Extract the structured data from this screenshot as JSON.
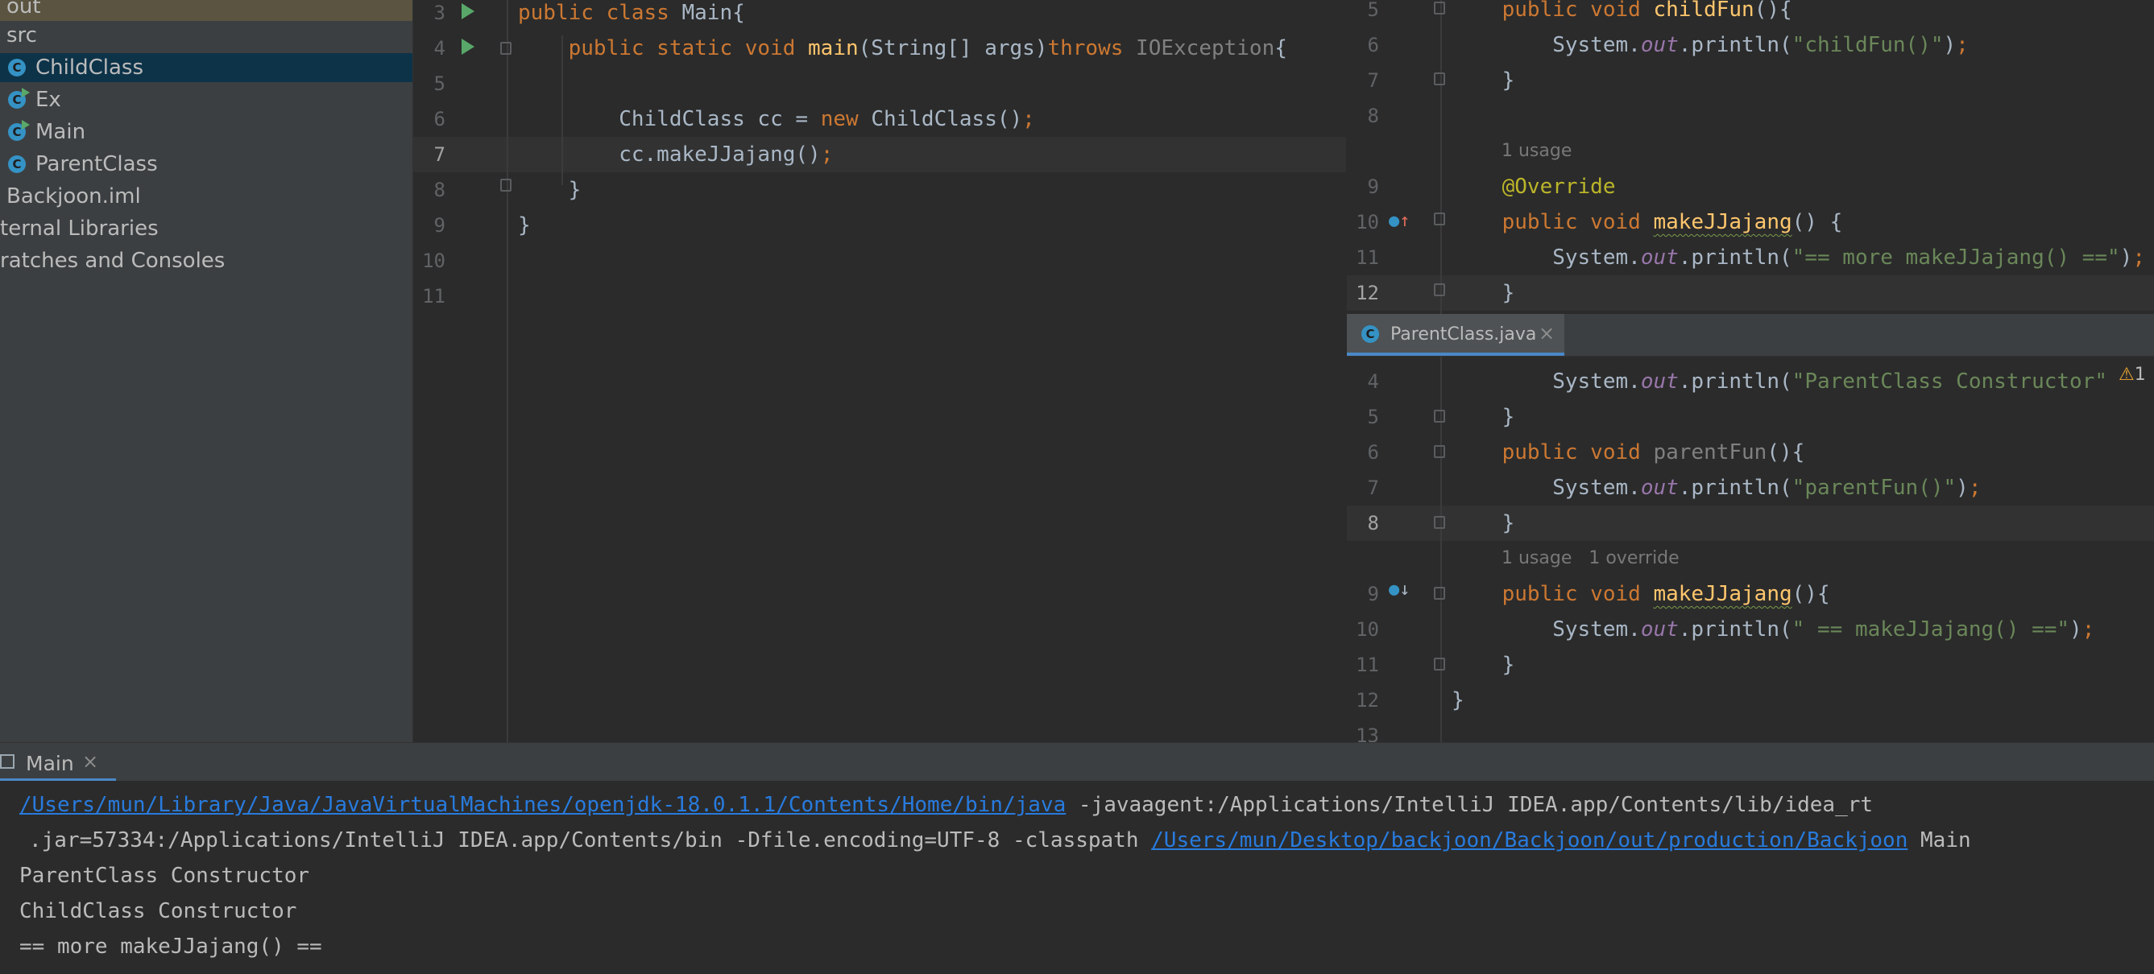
{
  "tree": {
    "items": [
      {
        "label": "out",
        "icon": "",
        "indent": 0,
        "state": "top"
      },
      {
        "label": "src",
        "icon": "",
        "indent": 0,
        "state": ""
      },
      {
        "label": "ChildClass",
        "icon": "class-icon",
        "indent": 1,
        "state": "selected"
      },
      {
        "label": "Ex",
        "icon": "runnable-class-icon",
        "indent": 1,
        "state": ""
      },
      {
        "label": "Main",
        "icon": "runnable-class-icon",
        "indent": 1,
        "state": ""
      },
      {
        "label": "ParentClass",
        "icon": "class-icon",
        "indent": 1,
        "state": ""
      },
      {
        "label": "Backjoon.iml",
        "icon": "",
        "indent": 0,
        "state": ""
      },
      {
        "label": "ternal Libraries",
        "icon": "",
        "indent": 0,
        "state": ""
      },
      {
        "label": "ratches and Consoles",
        "icon": "",
        "indent": 0,
        "state": ""
      }
    ]
  },
  "main_editor": {
    "lines": [
      {
        "n": "3",
        "tokens": [
          {
            "t": "public class ",
            "c": "kw"
          },
          {
            "t": "Main{",
            "c": ""
          }
        ]
      },
      {
        "n": "4",
        "tokens": [
          {
            "t": "    public static void ",
            "c": "kw"
          },
          {
            "t": "main",
            "c": "fn"
          },
          {
            "t": "(String[] args)",
            "c": ""
          },
          {
            "t": "throws ",
            "c": "kw"
          },
          {
            "t": "IOException",
            "c": "gray"
          },
          {
            "t": "{",
            "c": ""
          }
        ]
      },
      {
        "n": "5",
        "tokens": []
      },
      {
        "n": "6",
        "tokens": [
          {
            "t": "        ChildClass cc = ",
            "c": ""
          },
          {
            "t": "new ",
            "c": "kw"
          },
          {
            "t": "ChildClass()",
            "c": ""
          },
          {
            "t": ";",
            "c": "kw"
          }
        ]
      },
      {
        "n": "7",
        "tokens": [
          {
            "t": "        cc.makeJJajang()",
            "c": ""
          },
          {
            "t": ";",
            "c": "kw"
          }
        ],
        "current": true
      },
      {
        "n": "8",
        "tokens": [
          {
            "t": "    }",
            "c": ""
          }
        ]
      },
      {
        "n": "9",
        "tokens": [
          {
            "t": "}",
            "c": ""
          }
        ]
      },
      {
        "n": "10",
        "tokens": []
      },
      {
        "n": "11",
        "tokens": []
      }
    ]
  },
  "child_editor": {
    "lines": [
      {
        "n": "5",
        "tokens": [
          {
            "t": "    public void ",
            "c": "kw"
          },
          {
            "t": "childFun",
            "c": "fn"
          },
          {
            "t": "(){",
            "c": ""
          }
        ]
      },
      {
        "n": "6",
        "tokens": [
          {
            "t": "        System.",
            "c": ""
          },
          {
            "t": "out",
            "c": "field"
          },
          {
            "t": ".println(",
            "c": ""
          },
          {
            "t": "\"childFun()\"",
            "c": "str"
          },
          {
            "t": ")",
            "c": ""
          },
          {
            "t": ";",
            "c": "kw"
          }
        ]
      },
      {
        "n": "7",
        "tokens": [
          {
            "t": "    }",
            "c": ""
          }
        ]
      },
      {
        "n": "8",
        "tokens": []
      },
      {
        "n": "",
        "hint": "1 usage"
      },
      {
        "n": "9",
        "tokens": [
          {
            "t": "    @Override",
            "c": "ann"
          }
        ]
      },
      {
        "n": "10",
        "tokens": [
          {
            "t": "    public void ",
            "c": "kw"
          },
          {
            "t": "makeJJajang",
            "c": "fn wavy"
          },
          {
            "t": "() {",
            "c": ""
          }
        ]
      },
      {
        "n": "11",
        "tokens": [
          {
            "t": "        System.",
            "c": ""
          },
          {
            "t": "out",
            "c": "field"
          },
          {
            "t": ".println(",
            "c": ""
          },
          {
            "t": "\"== more makeJJajang() ==\"",
            "c": "str"
          },
          {
            "t": ")",
            "c": ""
          },
          {
            "t": ";",
            "c": "kw"
          }
        ]
      },
      {
        "n": "12",
        "tokens": [
          {
            "t": "    }",
            "c": ""
          }
        ],
        "current": true
      }
    ]
  },
  "parent_tab": {
    "label": "ParentClass.java",
    "close": "×"
  },
  "parent_editor": {
    "lines": [
      {
        "n": "4",
        "tokens": [
          {
            "t": "        System.",
            "c": ""
          },
          {
            "t": "out",
            "c": "field"
          },
          {
            "t": ".println(",
            "c": ""
          },
          {
            "t": "\"ParentClass Constructor\"",
            "c": "str"
          }
        ]
      },
      {
        "n": "5",
        "tokens": [
          {
            "t": "    }",
            "c": ""
          }
        ]
      },
      {
        "n": "6",
        "tokens": [
          {
            "t": "    public void ",
            "c": "kw"
          },
          {
            "t": "parentFun",
            "c": "gray"
          },
          {
            "t": "(){",
            "c": ""
          }
        ]
      },
      {
        "n": "7",
        "tokens": [
          {
            "t": "        System.",
            "c": ""
          },
          {
            "t": "out",
            "c": "field"
          },
          {
            "t": ".println(",
            "c": ""
          },
          {
            "t": "\"parentFun()\"",
            "c": "str"
          },
          {
            "t": ")",
            "c": ""
          },
          {
            "t": ";",
            "c": "kw"
          }
        ]
      },
      {
        "n": "8",
        "tokens": [
          {
            "t": "    }",
            "c": ""
          }
        ],
        "current": true
      },
      {
        "n": "",
        "hint": "1 usage   1 override"
      },
      {
        "n": "9",
        "tokens": [
          {
            "t": "    public void ",
            "c": "kw"
          },
          {
            "t": "makeJJajang",
            "c": "fn wavy"
          },
          {
            "t": "(){",
            "c": ""
          }
        ]
      },
      {
        "n": "10",
        "tokens": [
          {
            "t": "        System.",
            "c": ""
          },
          {
            "t": "out",
            "c": "field"
          },
          {
            "t": ".println(",
            "c": ""
          },
          {
            "t": "\" == makeJJajang() ==\"",
            "c": "str"
          },
          {
            "t": ")",
            "c": ""
          },
          {
            "t": ";",
            "c": "kw"
          }
        ]
      },
      {
        "n": "11",
        "tokens": [
          {
            "t": "    }",
            "c": ""
          }
        ]
      },
      {
        "n": "12",
        "tokens": [
          {
            "t": "}",
            "c": ""
          }
        ]
      },
      {
        "n": "13",
        "tokens": []
      }
    ],
    "warning_count": "1"
  },
  "run_panel": {
    "tab_label": "Main",
    "close": "×",
    "console": {
      "cmd_link1": "/Users/mun/Library/Java/JavaVirtualMachines/openjdk-18.0.1.1/Contents/Home/bin/java",
      "cmd_rest1": " -javaagent:/Applications/IntelliJ IDEA.app/Contents/lib/idea_rt",
      "cmd_rest2": ".jar=57334:/Applications/IntelliJ IDEA.app/Contents/bin -Dfile.encoding=UTF-8 -classpath ",
      "cmd_link2": "/Users/mun/Desktop/backjoon/Backjoon/out/production/Backjoon",
      "cmd_rest3": " Main",
      "output": [
        "ParentClass Constructor",
        "ChildClass Constructor",
        "== more makeJJajang() =="
      ]
    }
  },
  "colors": {
    "keyword": "#cc7832",
    "function": "#ffc66d",
    "string": "#6a8759",
    "annotation": "#bbb529",
    "link": "#287bde",
    "selection": "#0d3349"
  }
}
